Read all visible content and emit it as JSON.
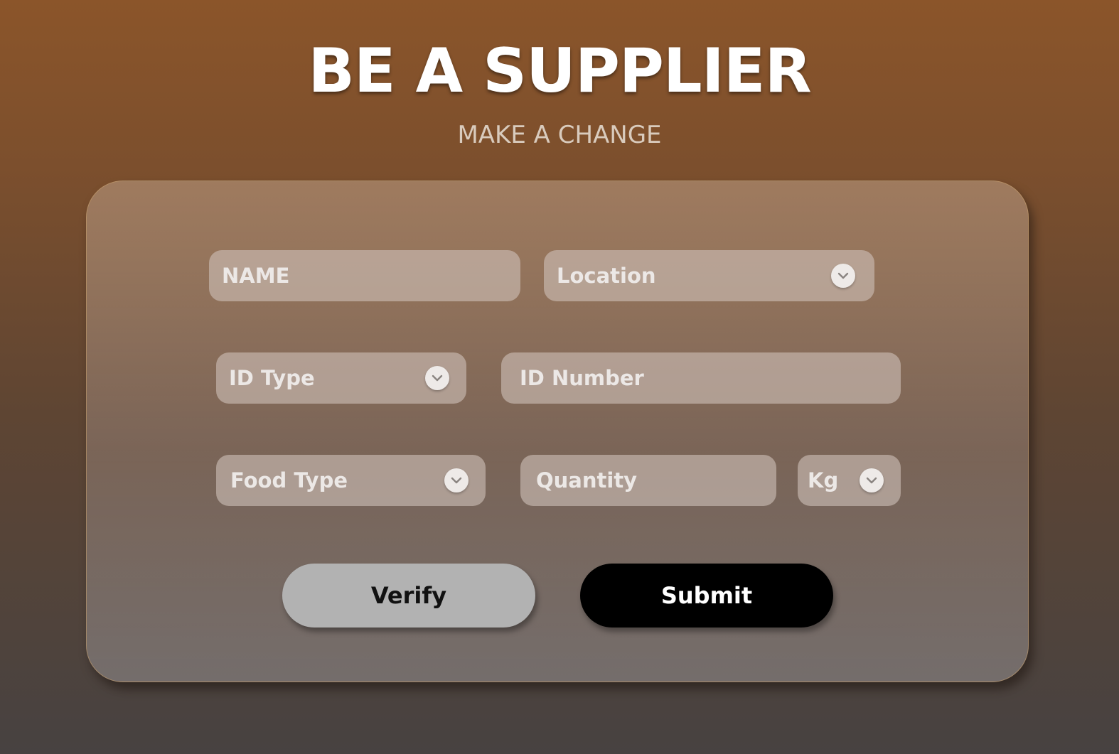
{
  "header": {
    "title": "BE A SUPPLIER",
    "subtitle": "MAKE A CHANGE"
  },
  "form": {
    "name_placeholder": "NAME",
    "location_placeholder": "Location",
    "id_type_placeholder": "ID Type",
    "id_number_placeholder": "ID Number",
    "food_type_placeholder": "Food Type",
    "quantity_placeholder": "Quantity",
    "unit_selected": "Kg"
  },
  "actions": {
    "verify_label": "Verify",
    "submit_label": "Submit"
  },
  "icons": {
    "dropdown": "chevron-down-icon"
  },
  "colors": {
    "background_top": "#8b552a",
    "background_bottom": "#474241",
    "submit_button": "#000000",
    "verify_button": "#b2b2b2"
  }
}
